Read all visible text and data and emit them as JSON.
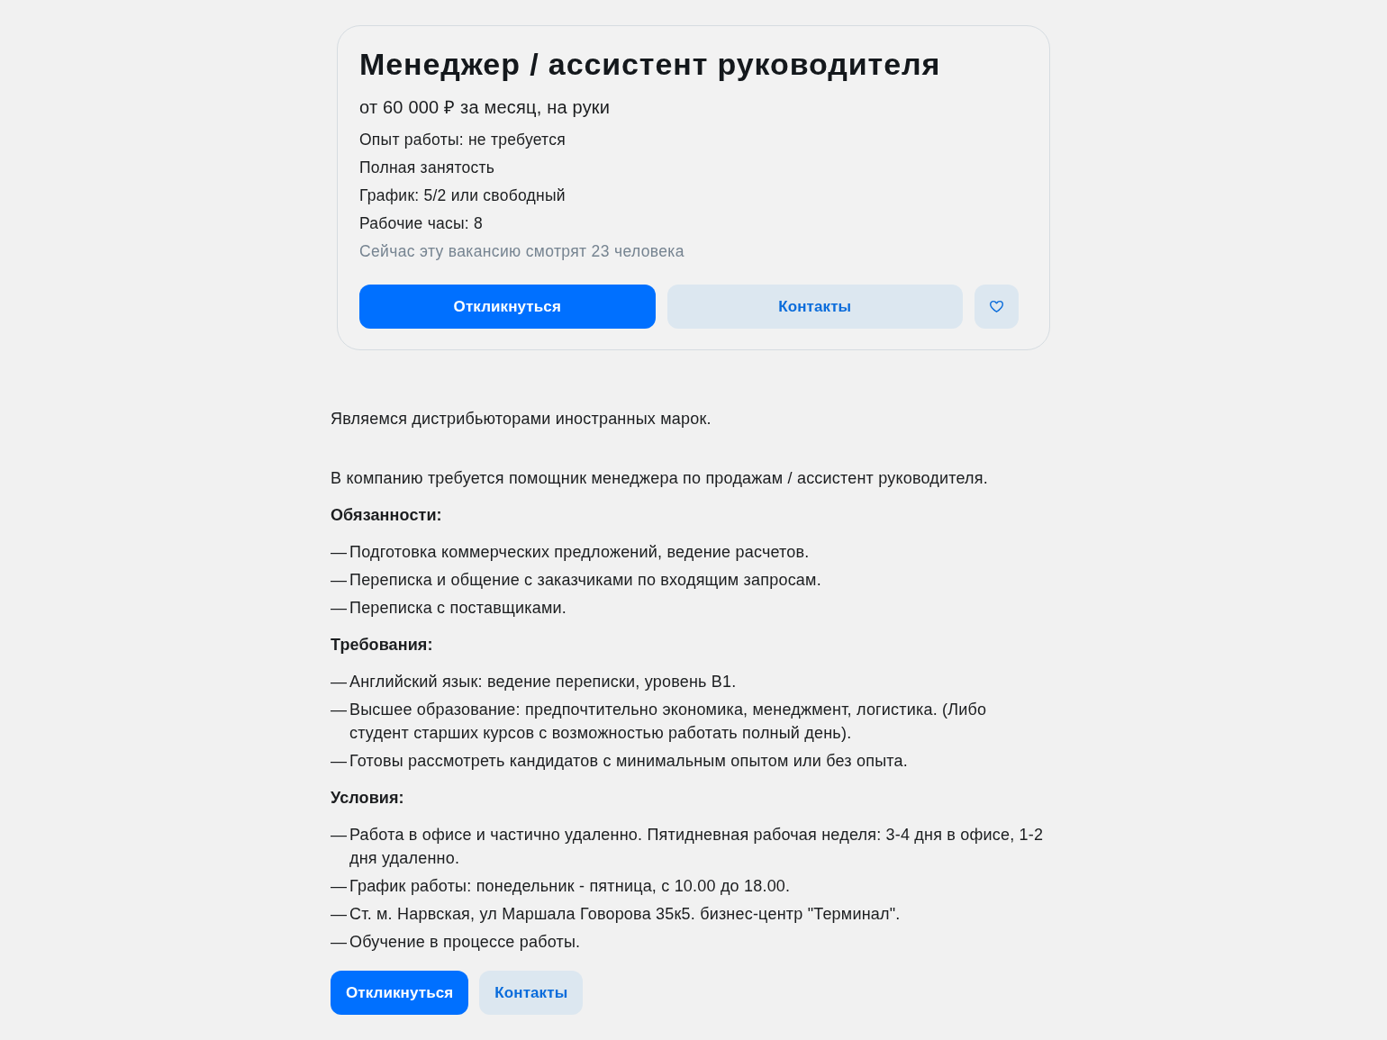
{
  "vacancy": {
    "title": "Менеджер / ассистент руководителя",
    "salary": "от 60 000 ₽ за месяц, на руки",
    "details": [
      "Опыт работы: не требуется",
      "Полная занятость",
      "График: 5/2 или свободный",
      "Рабочие часы: 8"
    ],
    "viewers": "Сейчас эту вакансию смотрят 23 человека",
    "actions": {
      "respond": "Откликнуться",
      "contacts": "Контакты",
      "favorite": false
    }
  },
  "description": [
    {
      "kind": "paragraph",
      "text": "Являемся дистрибьюторами иностранных марок."
    },
    {
      "kind": "paragraph",
      "text": "В компанию требуется помощник менеджера по продажам / ассистент руководителя."
    },
    {
      "kind": "heading",
      "text": "Обязанности:"
    },
    {
      "kind": "list",
      "items": [
        {
          "marker": "—",
          "text": "Подготовка коммерческих предложений, ведение расчетов."
        },
        {
          "marker": "—",
          "text": "Переписка и общение с заказчиками по входящим запросам."
        },
        {
          "marker": "—",
          "text": "Переписка с поставщиками."
        }
      ]
    },
    {
      "kind": "heading",
      "text": "Требования:"
    },
    {
      "kind": "list",
      "items": [
        {
          "marker": "—",
          "text": "Английский язык: ведение переписки, уровень B1."
        },
        {
          "marker": "—",
          "text": "Высшее образование: предпочтительно экономика, менеджмент, логистика. (Либо студент старших курсов с возможностью работать полный день)."
        },
        {
          "marker": "—",
          "text": "Готовы рассмотреть кандидатов с минимальным опытом или без опыта."
        }
      ]
    },
    {
      "kind": "heading",
      "text": "Условия:"
    },
    {
      "kind": "list",
      "items": [
        {
          "marker": "—",
          "text": "Работа в офисе и частично удаленно. Пятидневная рабочая неделя: 3-4 дня в офисе, 1-2 дня удаленно."
        },
        {
          "marker": "—",
          "text": "График работы: понедельник - пятница, с 10.00 до 18.00."
        },
        {
          "marker": "—",
          "text": "Ст. м. Нарвская, ул Маршала Говорова 35к5. бизнес-центр \"Терминал\"."
        },
        {
          "marker": "—",
          "text": "Обучение в процессе работы."
        }
      ]
    }
  ],
  "bottom_actions": {
    "respond": "Откликнуться",
    "contacts": "Контакты"
  }
}
